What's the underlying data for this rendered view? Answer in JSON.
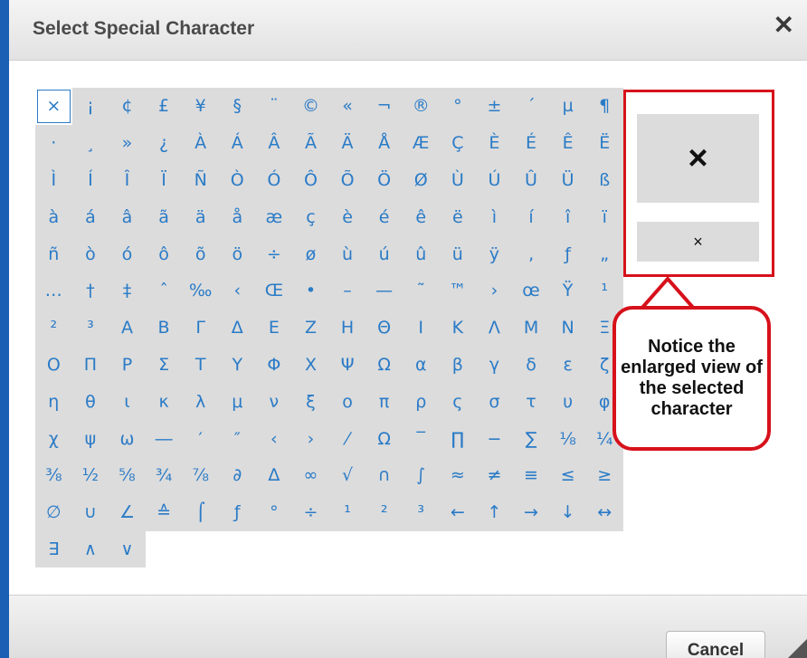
{
  "dialog": {
    "title": "Select Special Character",
    "close_glyph": "✕",
    "cancel_label": "Cancel"
  },
  "preview": {
    "selected_char": "×"
  },
  "callout": {
    "text": "Notice the enlarged view of the selected character"
  },
  "characters": [
    "×",
    "¡",
    "¢",
    "£",
    "¥",
    "§",
    "¨",
    "©",
    "«",
    "¬",
    "®",
    "°",
    "±",
    "´",
    "µ",
    "¶",
    "·",
    "¸",
    "»",
    "¿",
    "À",
    "Á",
    "Â",
    "Ã",
    "Ä",
    "Å",
    "Æ",
    "Ç",
    "È",
    "É",
    "Ê",
    "Ë",
    "Ì",
    "Í",
    "Î",
    "Ï",
    "Ñ",
    "Ò",
    "Ó",
    "Ô",
    "Õ",
    "Ö",
    "Ø",
    "Ù",
    "Ú",
    "Û",
    "Ü",
    "ß",
    "à",
    "á",
    "â",
    "ã",
    "ä",
    "å",
    "æ",
    "ç",
    "è",
    "é",
    "ê",
    "ë",
    "ì",
    "í",
    "î",
    "ï",
    "ñ",
    "ò",
    "ó",
    "ô",
    "õ",
    "ö",
    "÷",
    "ø",
    "ù",
    "ú",
    "û",
    "ü",
    "ÿ",
    "‚",
    "ƒ",
    "„",
    "…",
    "†",
    "‡",
    "ˆ",
    "‰",
    "‹",
    "Œ",
    "•",
    "–",
    "—",
    "˜",
    "™",
    "›",
    "œ",
    "Ÿ",
    "¹",
    "²",
    "³",
    "Α",
    "Β",
    "Γ",
    "Δ",
    "Ε",
    "Ζ",
    "Η",
    "Θ",
    "Ι",
    "Κ",
    "Λ",
    "Μ",
    "Ν",
    "Ξ",
    "Ο",
    "Π",
    "Ρ",
    "Σ",
    "Τ",
    "Υ",
    "Φ",
    "Χ",
    "Ψ",
    "Ω",
    "α",
    "β",
    "γ",
    "δ",
    "ε",
    "ζ",
    "η",
    "θ",
    "ι",
    "κ",
    "λ",
    "μ",
    "ν",
    "ξ",
    "ο",
    "π",
    "ρ",
    "ς",
    "σ",
    "τ",
    "υ",
    "φ",
    "χ",
    "ψ",
    "ω",
    "―",
    "′",
    "″",
    "‹",
    "›",
    "⁄",
    "Ω",
    "‾",
    "∏",
    "−",
    "∑",
    "⅛",
    "¼",
    "⅜",
    "½",
    "⅝",
    "¾",
    "⅞",
    "∂",
    "∆",
    "∞",
    "√",
    "∩",
    "∫",
    "≈",
    "≠",
    "≡",
    "≤",
    "≥",
    "∅",
    "∪",
    "∠",
    "≙",
    "⌠",
    "ƒ",
    "°",
    "÷",
    "¹",
    "²",
    "³",
    "←",
    "↑",
    "→",
    "↓",
    "↔",
    "∃",
    "∧",
    "∨"
  ],
  "colors": {
    "accent": "#2a7bc7",
    "callout_red": "#d6111b",
    "cell_bg": "#dcdcdc"
  }
}
